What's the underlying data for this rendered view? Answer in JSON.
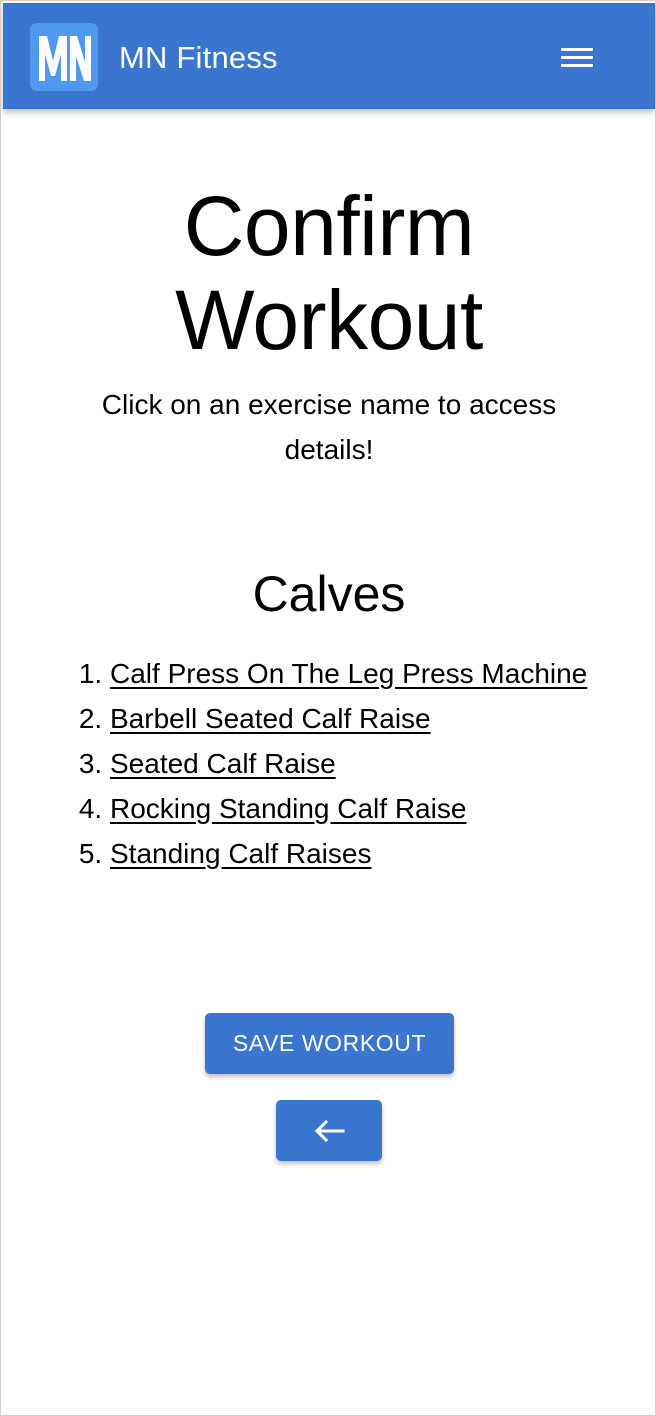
{
  "header": {
    "logo_text": "MN",
    "brand": "MN Fitness",
    "menu_icon": "hamburger-menu-icon",
    "color": "#3a76d0"
  },
  "main": {
    "title_line1": "Confirm",
    "title_line2": "Workout",
    "subtitle": "Click on an exercise name to access details!",
    "section": "Calves",
    "exercises": [
      "Calf Press On The Leg Press Machine",
      "Barbell Seated Calf Raise",
      "Seated Calf Raise",
      "Rocking Standing Calf Raise",
      "Standing Calf Raises"
    ]
  },
  "actions": {
    "save_label": "SAVE WORKOUT",
    "back_icon": "arrow-left-icon",
    "button_color": "#3a76d0"
  }
}
